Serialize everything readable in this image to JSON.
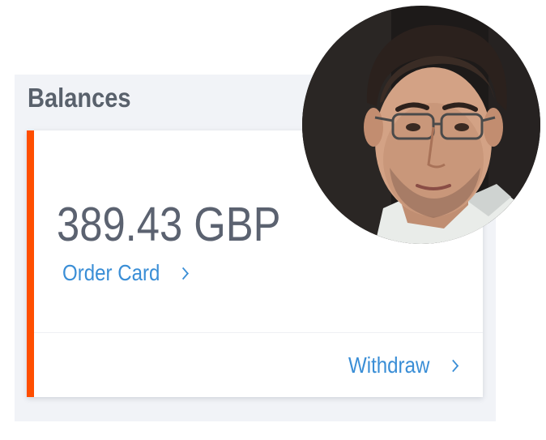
{
  "balances": {
    "title": "Balances",
    "amount": "389.43 GBP",
    "order_card_label": "Order Card",
    "withdraw_label": "Withdraw"
  },
  "colors": {
    "accent": "#ff4e00",
    "link": "#3a8ed6",
    "text": "#5b6270",
    "panel_bg": "#f1f3f7"
  },
  "icons": {
    "order_card_chevron": "chevron-right-icon",
    "withdraw_chevron": "chevron-right-icon"
  }
}
